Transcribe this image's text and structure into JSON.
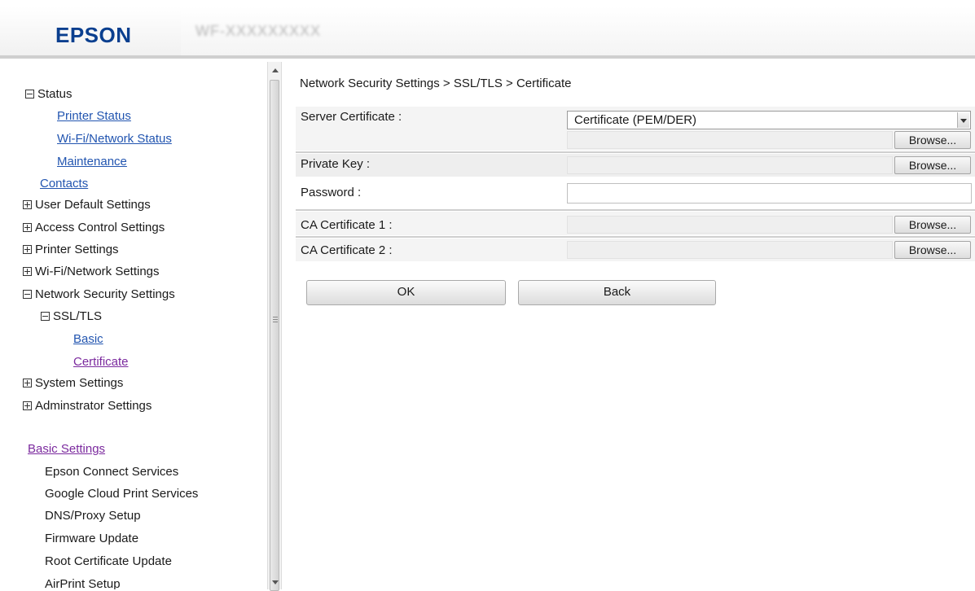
{
  "header": {
    "brand": "EPSON",
    "model": "WF-XXXXXXXXX"
  },
  "sidebar": {
    "status": "Status",
    "printer_status": "Printer Status",
    "wifi_network_status": "Wi-Fi/Network Status",
    "maintenance": "Maintenance",
    "contacts": "Contacts",
    "user_default_settings": "User Default Settings",
    "access_control_settings": "Access Control Settings",
    "printer_settings": "Printer Settings",
    "wifi_network_settings": "Wi-Fi/Network Settings",
    "network_security_settings": "Network Security Settings",
    "ssl_tls": "SSL/TLS",
    "basic": "Basic",
    "certificate": "Certificate",
    "system_settings": "System Settings",
    "administrator_settings": "Adminstrator Settings",
    "basic_settings": "Basic Settings",
    "basic_items": [
      "Epson Connect Services",
      "Google Cloud Print Services",
      "DNS/Proxy Setup",
      "Firmware Update",
      "Root Certificate Update",
      "AirPrint Setup"
    ]
  },
  "main": {
    "breadcrumb": "Network Security Settings > SSL/TLS > Certificate",
    "server_certificate_label": "Server Certificate :",
    "server_certificate_value": "Certificate (PEM/DER)",
    "private_key_label": "Private Key :",
    "password_label": "Password :",
    "ca_certificate_1_label": "CA Certificate 1 :",
    "ca_certificate_2_label": "CA Certificate 2 :",
    "browse_label": "Browse...",
    "ok_label": "OK",
    "back_label": "Back"
  },
  "colors": {
    "brand_blue": "#0a3f8f",
    "link_blue": "#2255b0",
    "link_visited": "#7b2a9e"
  }
}
